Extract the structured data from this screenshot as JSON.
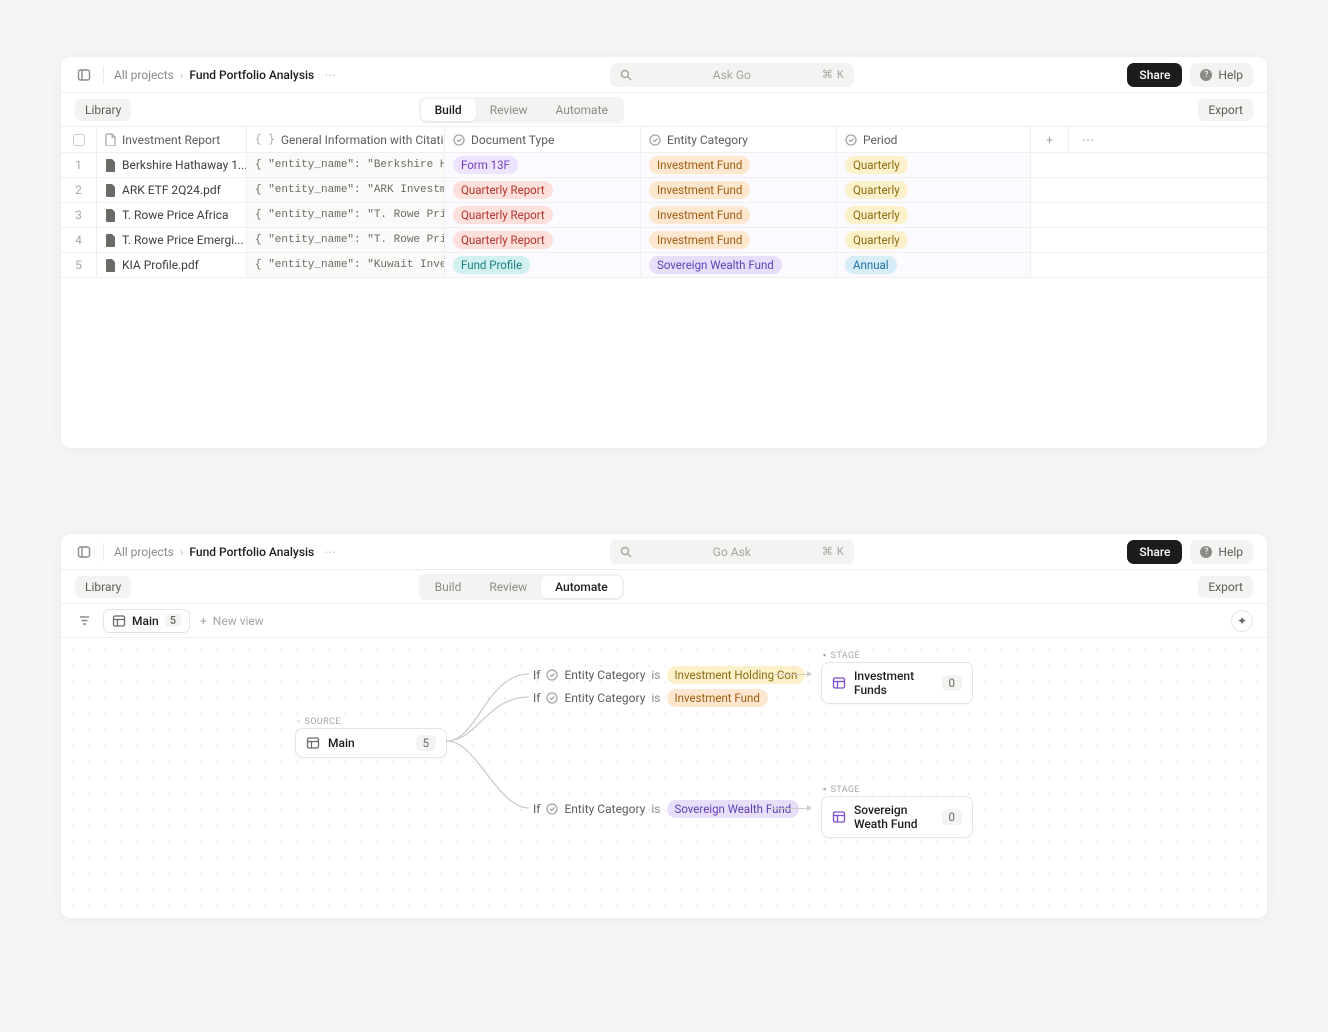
{
  "common": {
    "breadcrumb_root": "All projects",
    "breadcrumb_current": "Fund Portfolio Analysis",
    "share": "Share",
    "help": "Help",
    "library": "Library",
    "export": "Export",
    "kbd_cmd": "⌘",
    "kbd_k": "K"
  },
  "panel1": {
    "search_placeholder": "Ask Go",
    "tabs": {
      "build": "Build",
      "review": "Review",
      "automate": "Automate"
    },
    "columns": {
      "c0": "Investment Report",
      "c1": "General Information with Citations",
      "c2": "Document Type",
      "c3": "Entity Category",
      "c4": "Period"
    },
    "rows": [
      {
        "n": "1",
        "file": "Berkshire Hathaway 1...",
        "json": "{ \"entity_name\": \"Berkshire Hathaway Inc\"...",
        "doctype": "Form 13F",
        "doctype_class": "pill-purple",
        "entity": "Investment Fund",
        "entity_class": "pill-orange",
        "period": "Quarterly",
        "period_class": "pill-yellow"
      },
      {
        "n": "2",
        "file": "ARK ETF 2Q24.pdf",
        "json": "{ \"entity_name\": \"ARK Investment Manage...",
        "doctype": "Quarterly Report",
        "doctype_class": "pill-red",
        "entity": "Investment Fund",
        "entity_class": "pill-orange",
        "period": "Quarterly",
        "period_class": "pill-yellow"
      },
      {
        "n": "3",
        "file": "T. Rowe Price Africa",
        "json": "{ \"entity_name\": \"T. Rowe Price\", \"fund_na...",
        "doctype": "Quarterly Report",
        "doctype_class": "pill-red",
        "entity": "Investment Fund",
        "entity_class": "pill-orange",
        "period": "Quarterly",
        "period_class": "pill-yellow"
      },
      {
        "n": "4",
        "file": "T. Rowe Price Emergi...",
        "json": "{ \"entity_name\": \"T. Rowe Price\", \"fund_na...",
        "doctype": "Quarterly Report",
        "doctype_class": "pill-red",
        "entity": "Investment Fund",
        "entity_class": "pill-orange",
        "period": "Quarterly",
        "period_class": "pill-yellow"
      },
      {
        "n": "5",
        "file": "KIA Profile.pdf",
        "json": "{ \"entity_name\": \"Kuwait Investment Auth...",
        "doctype": "Fund Profile",
        "doctype_class": "pill-cyan",
        "entity": "Sovereign Wealth Fund",
        "entity_class": "pill-violet",
        "period": "Annual",
        "period_class": "pill-blue"
      }
    ]
  },
  "panel2": {
    "search_placeholder": "Go Ask",
    "tabs": {
      "build": "Build",
      "review": "Review",
      "automate": "Automate"
    },
    "view": {
      "name": "Main",
      "count": "5",
      "new": "New view"
    },
    "source_label": "SOURCE",
    "stage_label": "STAGE",
    "source_node": {
      "name": "Main",
      "count": "5"
    },
    "stage1": {
      "name": "Investment Funds",
      "count": "0"
    },
    "stage2": {
      "name": "Sovereign Weath Fund",
      "count": "0"
    },
    "cond_field": "Entity Category",
    "if": "If",
    "is": "is",
    "cond1_val": "Investment Holding Con",
    "cond1_class": "pill-yellow",
    "cond2_val": "Investment Fund",
    "cond2_class": "pill-orange",
    "cond3_val": "Sovereign Wealth Fund",
    "cond3_class": "pill-violet"
  }
}
